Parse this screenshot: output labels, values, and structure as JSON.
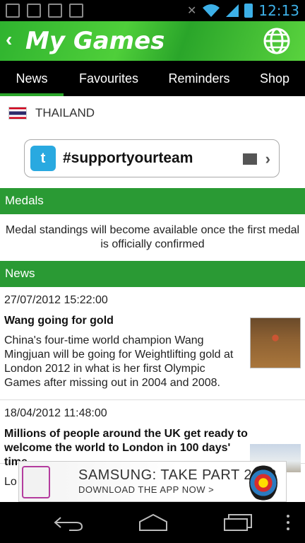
{
  "status_bar": {
    "time": "12:13",
    "icons": [
      "shield-icon",
      "image-icon",
      "checklist-icon",
      "gmail-icon",
      "mute-icon",
      "wifi-icon",
      "signal-icon",
      "battery-icon"
    ]
  },
  "header": {
    "back_label": "‹",
    "title": "My Games"
  },
  "tabs": [
    "News",
    "Favourites",
    "Reminders",
    "Shop"
  ],
  "active_tab": "News",
  "country": {
    "name": "THAILAND"
  },
  "twitter": {
    "hashtag": "#supportyourteam"
  },
  "medals": {
    "heading": "Medals",
    "note": "Medal standings will become available once the first medal is officially confirmed"
  },
  "news": {
    "heading": "News",
    "items": [
      {
        "date": "27/07/2012 15:22:00",
        "headline": "Wang going for gold",
        "summary": "China's four-time world champion Wang Mingjuan will be going for Weightlifting gold at London 2012 in what is her first Olympic Games after missing out in 2004 and 2008."
      },
      {
        "date": "18/04/2012 11:48:00",
        "headline": "Millions of people around the UK get ready to welcome the world to London in 100 days' time",
        "summary": "Lo"
      }
    ]
  },
  "ad": {
    "title": "SAMSUNG: TAKE PART 2012",
    "subtitle": "DOWNLOAD THE APP NOW >"
  },
  "colors": {
    "green": "#2a9a34",
    "accent_blue": "#3db0e8",
    "twitter_blue": "#29a9e0"
  }
}
